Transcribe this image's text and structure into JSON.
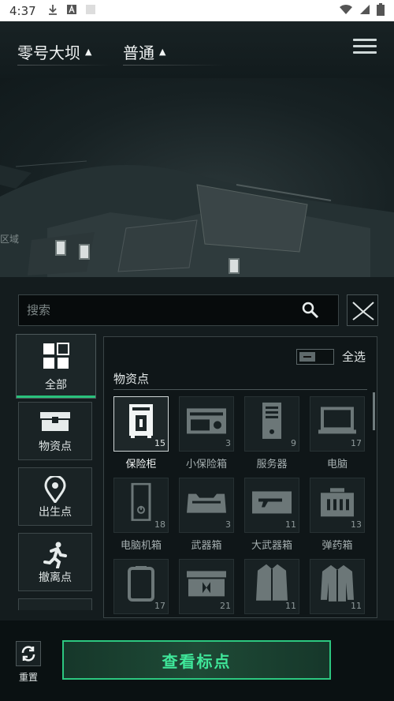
{
  "status_bar": {
    "time": "4:37",
    "icons": [
      "download-icon",
      "a-icon",
      "wifi-icon",
      "signal-icon",
      "battery-icon"
    ]
  },
  "header": {
    "map_name": "零号大坝",
    "difficulty": "普通"
  },
  "map": {
    "labels": [
      "区域"
    ]
  },
  "search": {
    "placeholder": "搜索"
  },
  "categories": [
    {
      "label": "全部",
      "icon": "grid-icon",
      "active": true
    },
    {
      "label": "物资点",
      "icon": "supply-crate-icon",
      "active": false
    },
    {
      "label": "出生点",
      "icon": "location-pin-icon",
      "active": false
    },
    {
      "label": "撤离点",
      "icon": "running-man-icon",
      "active": false
    }
  ],
  "filter": {
    "select_all_label": "全选",
    "section_title": "物资点"
  },
  "items": [
    {
      "label": "保险柜",
      "count": "15",
      "icon": "safe-icon",
      "active": true
    },
    {
      "label": "小保险箱",
      "count": "3",
      "icon": "small-safe-icon",
      "active": false
    },
    {
      "label": "服务器",
      "count": "9",
      "icon": "server-icon",
      "active": false
    },
    {
      "label": "电脑",
      "count": "17",
      "icon": "laptop-icon",
      "active": false
    },
    {
      "label": "电脑机箱",
      "count": "18",
      "icon": "pc-case-icon",
      "active": false
    },
    {
      "label": "武器箱",
      "count": "3",
      "icon": "weapon-box-icon",
      "active": false
    },
    {
      "label": "大武器箱",
      "count": "11",
      "icon": "large-weapon-box-icon",
      "active": false
    },
    {
      "label": "弹药箱",
      "count": "13",
      "icon": "ammo-box-icon",
      "active": false
    },
    {
      "label": "",
      "count": "17",
      "icon": "backpack-icon",
      "active": false
    },
    {
      "label": "",
      "count": "21",
      "icon": "medical-box-icon",
      "active": false
    },
    {
      "label": "",
      "count": "11",
      "icon": "coat-icon",
      "active": false
    },
    {
      "label": "",
      "count": "11",
      "icon": "jacket-icon",
      "active": false
    }
  ],
  "bottom": {
    "reset_label": "重置",
    "view_button_label": "查看标点"
  },
  "colors": {
    "accent": "#2cc780",
    "background": "#141c1e"
  }
}
